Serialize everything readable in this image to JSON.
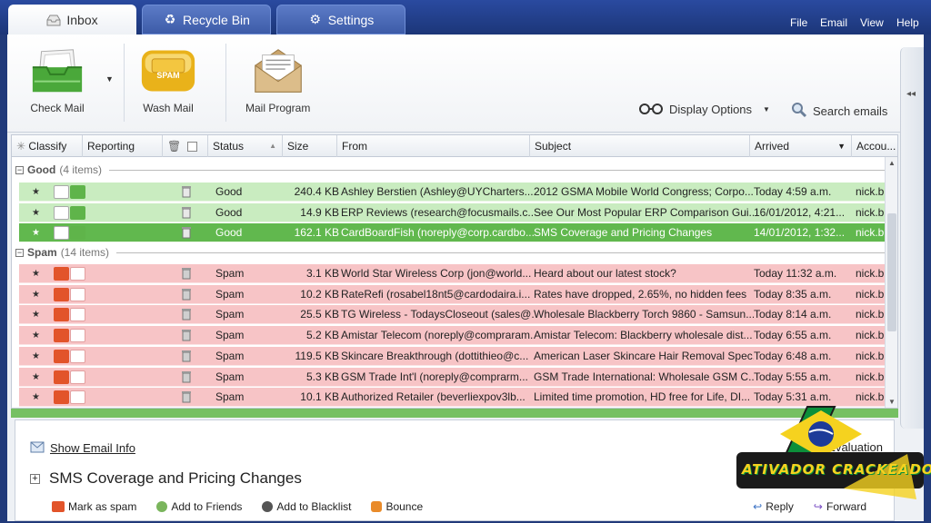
{
  "tabs": [
    {
      "label": "Inbox",
      "icon": "inbox-icon",
      "active": true
    },
    {
      "label": "Recycle Bin",
      "icon": "recycle-icon",
      "active": false
    },
    {
      "label": "Settings",
      "icon": "gear-icon",
      "active": false
    }
  ],
  "menu": [
    "File",
    "Email",
    "View",
    "Help"
  ],
  "ribbon": {
    "check_mail": "Check Mail",
    "wash_mail": "Wash Mail",
    "wash_mail_badge": "SPAM",
    "mail_program": "Mail Program",
    "display_options": "Display Options",
    "search_emails": "Search emails"
  },
  "columns": {
    "classify": "Classify",
    "reporting": "Reporting",
    "status": "Status",
    "size": "Size",
    "from": "From",
    "subject": "Subject",
    "arrived": "Arrived",
    "account": "Accou..."
  },
  "groups": {
    "good": {
      "name": "Good",
      "count": "(4 items)"
    },
    "spam": {
      "name": "Spam",
      "count": "(14 items)"
    }
  },
  "good_rows": [
    {
      "status": "Good",
      "size": "240.4 KB",
      "from": "Ashley Berstien (Ashley@UYCharters....",
      "subject": "2012 GSMA Mobile World Congress; Corpo...",
      "arrived": "Today 4:59 a.m.",
      "account": "nick.b..."
    },
    {
      "status": "Good",
      "size": "14.9 KB",
      "from": "ERP Reviews (research@focusmails.c...",
      "subject": "See Our Most Popular ERP Comparison Gui...",
      "arrived": "16/01/2012, 4:21...",
      "account": "nick.b..."
    },
    {
      "status": "Good",
      "size": "162.1 KB",
      "from": "CardBoardFish (noreply@corp.cardbo...",
      "subject": "SMS Coverage and Pricing Changes",
      "arrived": "14/01/2012, 1:32...",
      "account": "nick.b...",
      "selected": true
    }
  ],
  "spam_rows": [
    {
      "status": "Spam",
      "size": "3.1 KB",
      "from": "World Star Wireless Corp (jon@world...",
      "subject": "Heard about our latest stock?",
      "arrived": "Today 11:32 a.m.",
      "account": "nick.b..."
    },
    {
      "status": "Spam",
      "size": "10.2 KB",
      "from": "RateRefi (rosabel18nt5@cardodaira.i...",
      "subject": "Rates have dropped, 2.65%, no hidden fees",
      "arrived": "Today 8:35 a.m.",
      "account": "nick.b..."
    },
    {
      "status": "Spam",
      "size": "25.5 KB",
      "from": "TG Wireless - TodaysCloseout (sales@...",
      "subject": "Wholesale Blackberry Torch 9860 - Samsun...",
      "arrived": "Today 8:14 a.m.",
      "account": "nick.b..."
    },
    {
      "status": "Spam",
      "size": "5.2 KB",
      "from": "Amistar Telecom (noreply@compraram...",
      "subject": "Amistar Telecom: Blackberry wholesale dist...",
      "arrived": "Today 6:55 a.m.",
      "account": "nick.b..."
    },
    {
      "status": "Spam",
      "size": "119.5 KB",
      "from": "Skincare Breakthrough (dottithieo@c...",
      "subject": "American Laser Skincare Hair Removal Spec...",
      "arrived": "Today 6:48 a.m.",
      "account": "nick.b..."
    },
    {
      "status": "Spam",
      "size": "5.3 KB",
      "from": "GSM Trade Int'l (noreply@comprarm...",
      "subject": "GSM Trade International: Wholesale GSM C...",
      "arrived": "Today 5:55 a.m.",
      "account": "nick.b..."
    },
    {
      "status": "Spam",
      "size": "10.1 KB",
      "from": "Authorized  Retailer (beverliexpov3lb...",
      "subject": "Limited time promotion, HD free for Life, DI...",
      "arrived": "Today 5:31 a.m.",
      "account": "nick.b..."
    }
  ],
  "preview": {
    "show_info": "Show Email Info",
    "evaluation": "Evaluation",
    "subject": "SMS Coverage and Pricing Changes",
    "mark_as_spam": "Mark as spam",
    "add_friends": "Add to Friends",
    "add_blacklist": "Add to Blacklist",
    "bounce": "Bounce",
    "reply": "Reply",
    "forward": "Forward"
  },
  "watermark": "ATIVADOR CRACKEADO",
  "colors": {
    "tab_bar": "#1c3678",
    "good_row": "#c9ecc0",
    "selected_row": "#61b84e",
    "spam_row": "#f7c4c6",
    "thumbs_up_good": "#5fb44a",
    "thumbs_down_spam": "#e2542a"
  }
}
